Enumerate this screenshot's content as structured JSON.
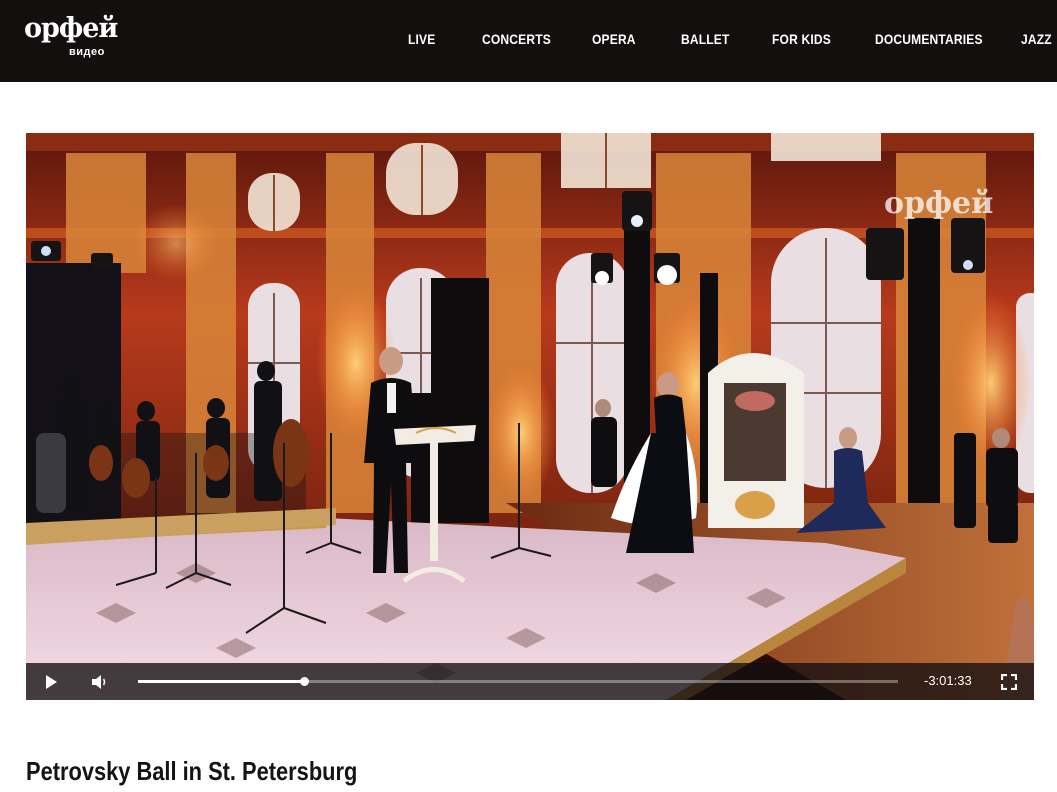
{
  "header": {
    "logo": {
      "word": "орфей",
      "sub": "видео"
    },
    "nav": [
      {
        "label": "LIVE"
      },
      {
        "label": "CONCERTS"
      },
      {
        "label": "OPERA"
      },
      {
        "label": "BALLET"
      },
      {
        "label": "FOR KIDS"
      },
      {
        "label": "DOCUMENTARIES"
      },
      {
        "label": "JAZZ"
      }
    ]
  },
  "player": {
    "watermark": "орфей",
    "time_remaining": "-3:01:33",
    "progress": 0.218,
    "icons": {
      "play": "play-icon",
      "volume": "volume-icon",
      "fullscreen": "fullscreen-icon"
    }
  },
  "video": {
    "title": "Petrovsky Ball in St. Petersburg"
  },
  "colors": {
    "header_bg": "#130f0f",
    "hall_glow": "#c8321a",
    "gold": "#d9a04a"
  }
}
